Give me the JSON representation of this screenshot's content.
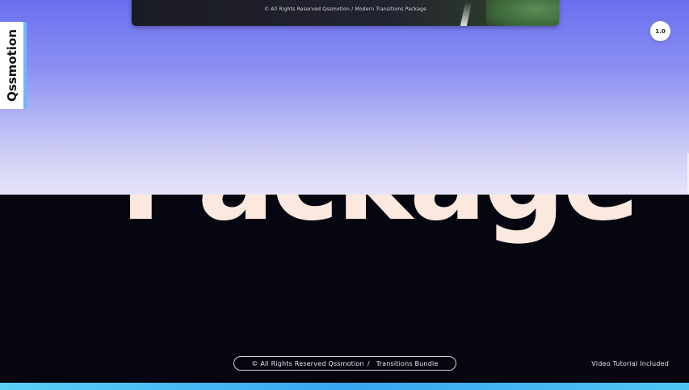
{
  "stage": {
    "big_word": "Package",
    "top_caption": "© All Rights Reserved Qssmotion / Modern Transitions Package",
    "brand": "Qssmotion",
    "speed_badge": "1.0",
    "footer": {
      "copyright": "© All Rights Reserved Qssmotion",
      "separator": "/",
      "bundle": "Transitions Bundle",
      "tutorial": "Video Tutorial Included"
    }
  },
  "colors": {
    "background": "#05060f",
    "gradient_top": "#6a6ff0",
    "gradient_bottom": "#e6e4f8",
    "big_word": "#fbe9e0",
    "accent_bar": "#38a5f0",
    "brand_tab_border": "#6fb7ff"
  },
  "icons": {
    "speed_badge": "speed-badge"
  }
}
